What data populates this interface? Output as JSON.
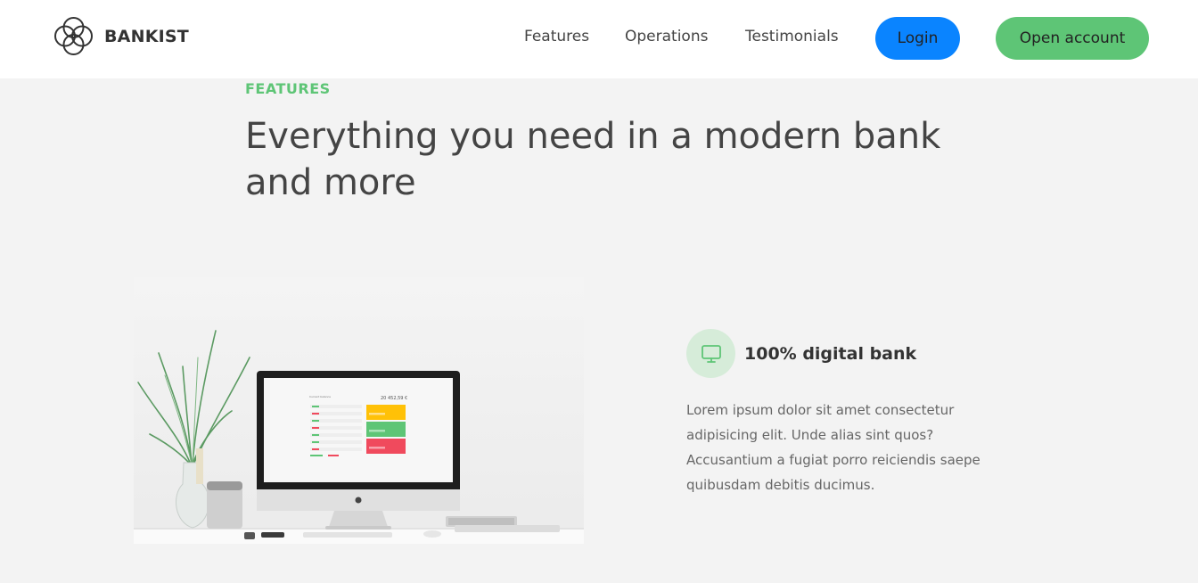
{
  "nav": {
    "brand": "BANKIST",
    "links": [
      "Features",
      "Operations",
      "Testimonials"
    ],
    "login_label": "Login",
    "open_account_label": "Open account"
  },
  "section": {
    "label": "FEATURES",
    "title": "Everything you need in a modern bank and more"
  },
  "features": [
    {
      "icon": "monitor-icon",
      "title": "100% digital bank",
      "text": "Lorem ipsum dolor sit amet consectetur adipisicing elit. Unde alias sint quos? Accusantium a fugiat porro reiciendis saepe quibusdam debitis ducimus."
    }
  ],
  "screen_mock": {
    "balance": "20 452,59 €"
  },
  "colors": {
    "accent_green": "#5ec576",
    "login_blue": "#0a84ff",
    "icon_bg": "#d6ecd9",
    "card_yellow": "#ffc107",
    "card_green": "#5ec576",
    "card_red": "#f04a5d"
  }
}
